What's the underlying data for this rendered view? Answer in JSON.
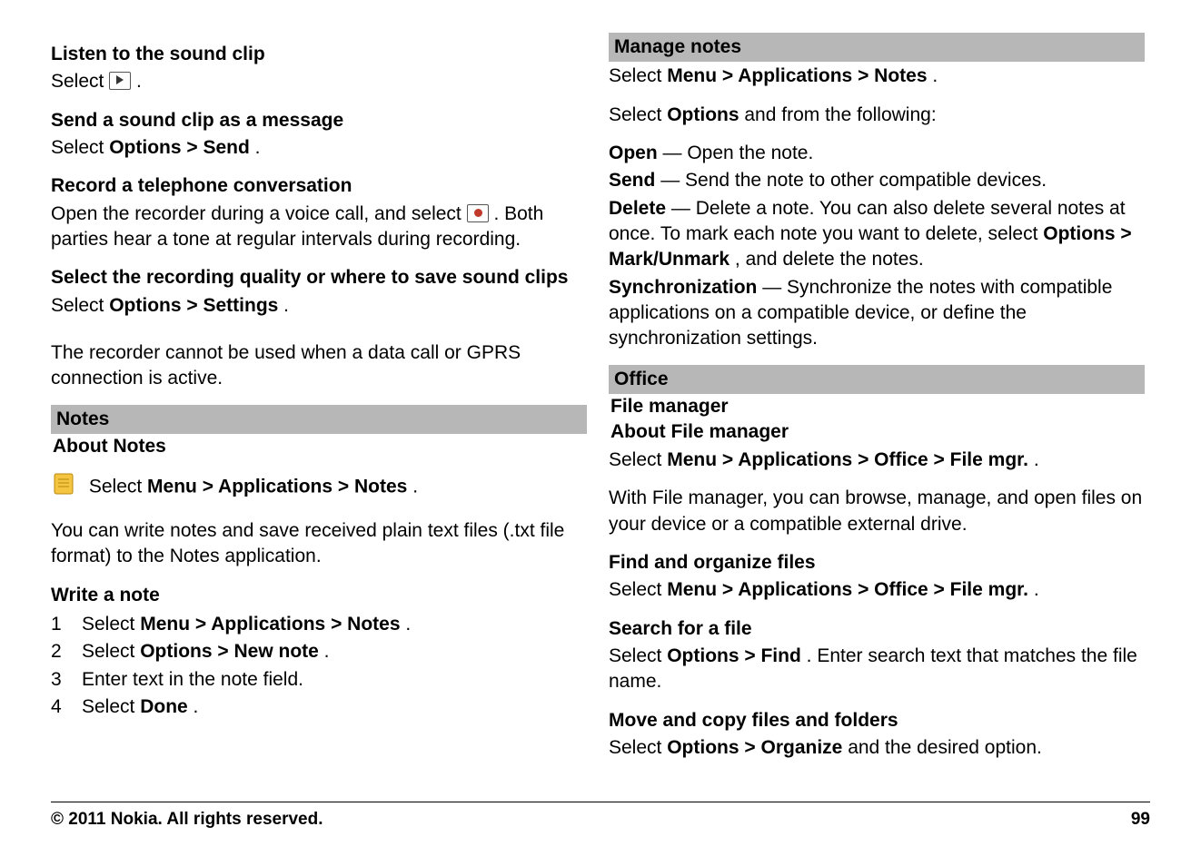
{
  "left": {
    "h_listen": "Listen to the sound clip",
    "listen_select_pre": "Select ",
    "listen_select_post": ".",
    "h_send": "Send a sound clip as a message",
    "send_para_pre": "Select ",
    "send_opt": "Options",
    "gt": " > ",
    "send_cmd": "Send",
    "period": ".",
    "h_record": "Record a telephone conversation",
    "record_pre": "Open the recorder during a voice call, and select ",
    "record_post": ". Both parties hear a tone at regular intervals during recording.",
    "h_quality": "Select the recording quality or where to save sound clips",
    "quality_pre": "Select ",
    "quality_opt": "Options",
    "quality_cmd": "Settings",
    "datacall_note": "The recorder cannot be used when a data call or GPRS connection is active.",
    "notes_bar": "Notes",
    "about_notes": "About Notes",
    "notes_path_pre": " Select ",
    "notes_menu": "Menu",
    "notes_apps": "Applications",
    "notes_notes": "Notes",
    "notes_desc": "You can write notes and save received plain text files (.txt file format) to the Notes application.",
    "h_write": "Write a note",
    "steps": [
      {
        "n": "1",
        "pre": "Select ",
        "a": "Menu",
        "b": "Applications",
        "c": "Notes",
        "post": "."
      },
      {
        "n": "2",
        "pre": "Select ",
        "a": "Options",
        "b": "New note",
        "c": "",
        "post": "."
      },
      {
        "n": "3",
        "pre": "Enter text in the note field.",
        "a": "",
        "b": "",
        "c": "",
        "post": ""
      },
      {
        "n": "4",
        "pre": "Select ",
        "a": "Done",
        "b": "",
        "c": "",
        "post": "."
      }
    ]
  },
  "right": {
    "manage_bar": "Manage notes",
    "manage_path_pre": "Select ",
    "menu": "Menu",
    "apps": "Applications",
    "notes": "Notes",
    "manage_sel_pre": "Select ",
    "options": "Options",
    "manage_sel_post": " and from the following:",
    "open_b": "Open",
    "open_t": "  — Open the note.",
    "send_b": "Send",
    "send_t": "  — Send the note to other compatible devices.",
    "del_b": "Delete",
    "del_t_1": "  — Delete a note. You can also delete several notes at once. To mark each note you want to delete, select ",
    "del_opt": "Options",
    "del_gt": " > ",
    "del_mark": "Mark/Unmark",
    "del_t_2": ", and delete the notes.",
    "sync_b": "Synchronization",
    "sync_t": "  — Synchronize the notes with compatible applications on a compatible device, or define the synchronization settings.",
    "office_bar": "Office",
    "filemgr_h": "File manager",
    "about_fm": "About File manager",
    "fm_path_pre": "Select ",
    "office": "Office",
    "filemgr": "File mgr.",
    "fm_desc": "With File manager, you can browse, manage, and open files on your device or a compatible external drive.",
    "h_find": "Find and organize files",
    "find_path_pre": "Select ",
    "h_search": "Search for a file",
    "search_pre": "Select ",
    "search_find": "Find",
    "search_post": ". Enter search text that matches the file name.",
    "h_move": "Move and copy files and folders",
    "move_pre": "Select ",
    "move_org": "Organize",
    "move_post": " and the desired option."
  },
  "footer": {
    "copyright": "© 2011 Nokia. All rights reserved.",
    "page": "99"
  }
}
